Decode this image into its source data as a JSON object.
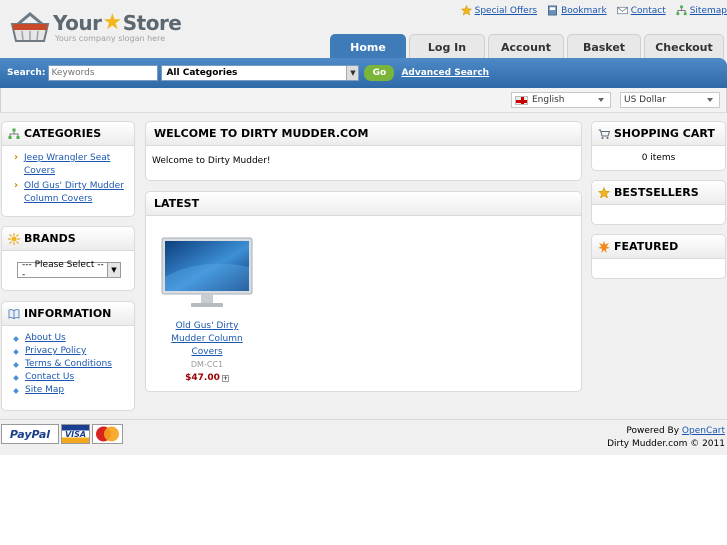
{
  "header": {
    "logo_word1": "Your",
    "logo_word2": "Store",
    "slogan": "Yours company slogan here",
    "links": [
      {
        "label": "Special Offers",
        "icon": "star-icon"
      },
      {
        "label": "Bookmark",
        "icon": "bookmark-icon"
      },
      {
        "label": "Contact",
        "icon": "envelope-icon"
      },
      {
        "label": "Sitemap",
        "icon": "sitemap-icon"
      }
    ]
  },
  "tabs": [
    {
      "label": "Home",
      "active": true
    },
    {
      "label": "Log In"
    },
    {
      "label": "Account"
    },
    {
      "label": "Basket"
    },
    {
      "label": "Checkout"
    }
  ],
  "search": {
    "label": "Search:",
    "placeholder": "Keywords",
    "category": "All Categories",
    "go": "Go",
    "advanced": "Advanced Search"
  },
  "settings": {
    "language": "English",
    "currency": "US Dollar"
  },
  "left": {
    "categories_title": "CATEGORIES",
    "categories": [
      "Jeep Wrangler Seat Covers",
      "Old Gus' Dirty Mudder Column Covers"
    ],
    "brands_title": "BRANDS",
    "brands_select": "--- Please Select ---",
    "information_title": "INFORMATION",
    "information": [
      "About Us",
      "Privacy Policy",
      "Terms & Conditions",
      "Contact Us",
      "Site Map"
    ]
  },
  "main": {
    "welcome_title": "WELCOME TO DIRTY MUDDER.COM",
    "welcome_text": "Welcome to Dirty Mudder!",
    "latest_title": "LATEST",
    "product": {
      "name": "Old Gus' Dirty Mudder Column Covers",
      "model": "DM-CC1",
      "price": "$47.00"
    }
  },
  "right": {
    "cart_title": "SHOPPING CART",
    "cart_text": "0 items",
    "bestsellers_title": "BESTSELLERS",
    "featured_title": "FEATURED"
  },
  "footer": {
    "powered_prefix": "Powered By",
    "powered_link": "OpenCart",
    "copyright": "Dirty Mudder.com © 2011",
    "payments": [
      "PayPal",
      "VISA",
      "MasterCard"
    ]
  },
  "colors": {
    "accent": "#3e7bb8",
    "link": "#1b57b1",
    "price": "#990000",
    "go_button": "#7ab53a"
  }
}
